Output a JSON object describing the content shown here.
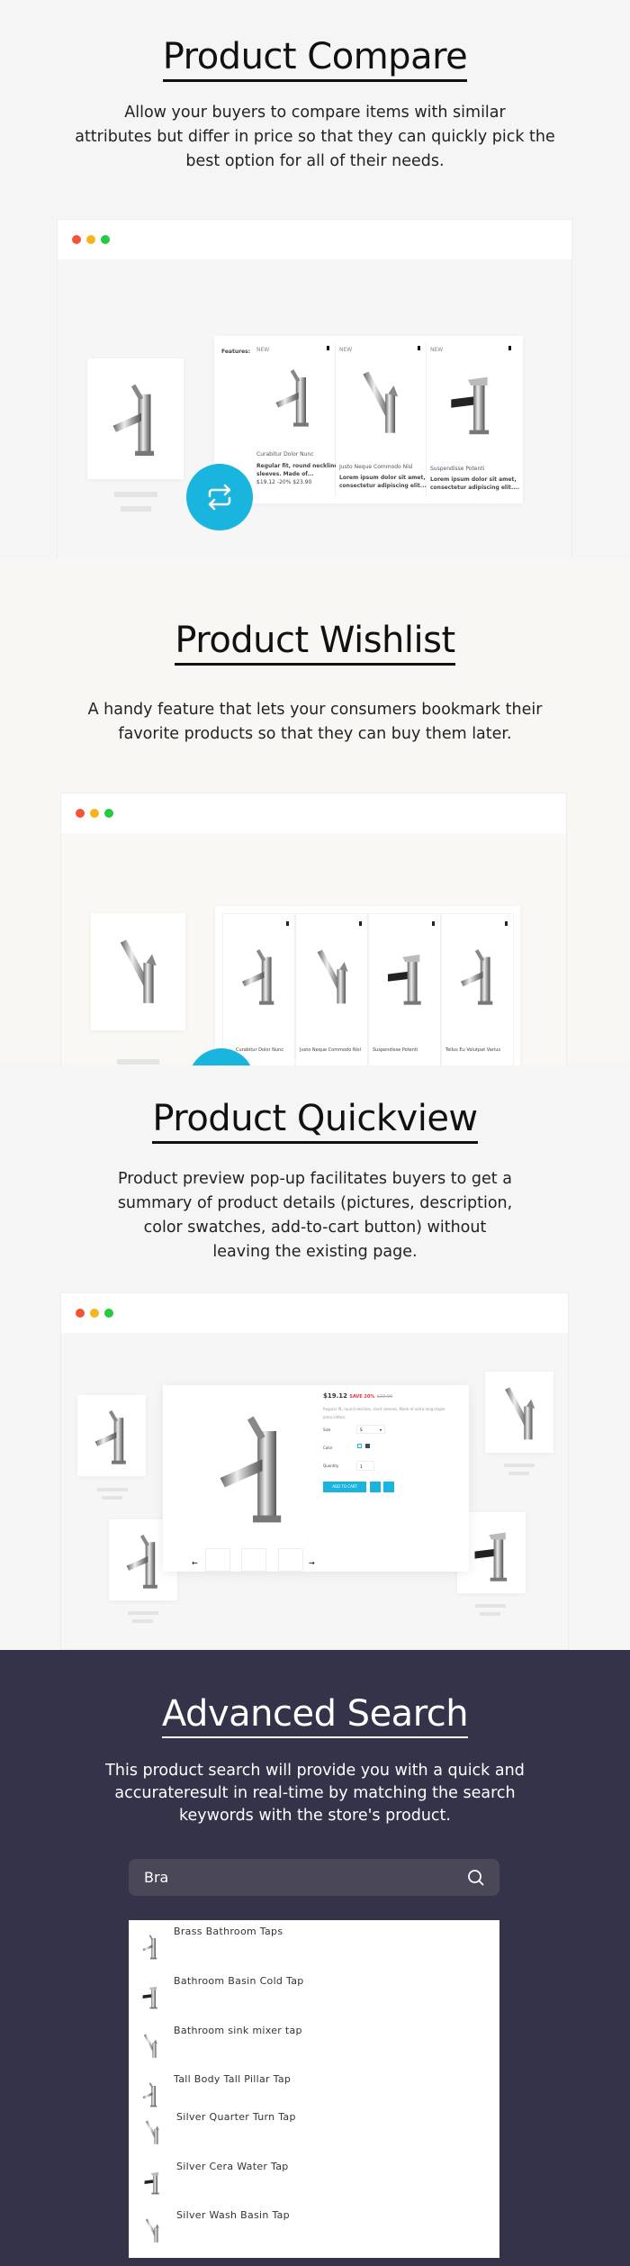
{
  "colors": {
    "accent": "#1ab5df",
    "dark_bg": "#35334a",
    "sale": "#e8344b"
  },
  "compare": {
    "title": "Product Compare",
    "description_lines": [
      "Allow your buyers to compare items with similar",
      "attributes but differ in price so that they can quickly pick the",
      "best option for all of their needs."
    ],
    "features_label": "Features:",
    "products": [
      {
        "badge": "NEW",
        "name": "Curabitur Dolor Nunc",
        "desc1": "Regular fit, round neckline, short",
        "desc2": "sleeves. Made of...",
        "price": "$19.12 -20% $23.90"
      },
      {
        "badge": "NEW",
        "name": "Justo Neque Commodo Nisl",
        "desc1": "Lorem ipsum dolor sit amet,",
        "desc2": "consectetur adipiscing elit....",
        "price": ""
      },
      {
        "badge": "NEW",
        "name": "Suspendisse Potenti",
        "desc1": "Lorem ipsum dolor sit amet,",
        "desc2": "consectetur adipiscing elit....",
        "price": ""
      }
    ],
    "fab_icon": "compare-arrows-icon"
  },
  "wishlist": {
    "title": "Product Wishlist",
    "description_lines": [
      "A handy feature that lets your consumers bookmark their",
      "favorite products so that they can buy them later."
    ],
    "products": [
      "Curabitur Dolor Nunc",
      "Justo Neque Commodo Nisl",
      "Suspendisse Potenti",
      "Tellus Eu Volutpat Varius"
    ],
    "fab_icon": "heart-icon"
  },
  "quickview": {
    "title": "Product Quickview",
    "description_lines": [
      "Product preview pop-up facilitates buyers to get a",
      "summary of product details (pictures, description,",
      "color swatches, add-to-cart button) without",
      "leaving the existing page."
    ],
    "price": "$19.12",
    "save": "SAVE 20%",
    "old_price": "$23.90",
    "short_desc": "Regular fit, round neckline, short sleeves. Made of extra long staple pima cotton.",
    "size_label": "Size",
    "size_value": "S",
    "color_label": "Color",
    "quantity_label": "Quantity",
    "quantity_value": "1",
    "add_to_cart": "ADD TO CART"
  },
  "search": {
    "title": "Advanced Search",
    "description_lines": [
      "This product search will provide you with a quick and",
      "accurateresult in real-time by matching the search",
      "keywords with the store's product."
    ],
    "query": "Bra",
    "results": [
      "Brass Bathroom Taps",
      "Bathroom Basin Cold Tap",
      "Bathroom sink mixer tap",
      "Tall Body Tall Pillar Tap",
      "Silver Quarter Turn Tap",
      "Silver Cera Water Tap",
      "Silver Wash Basin Tap"
    ]
  }
}
